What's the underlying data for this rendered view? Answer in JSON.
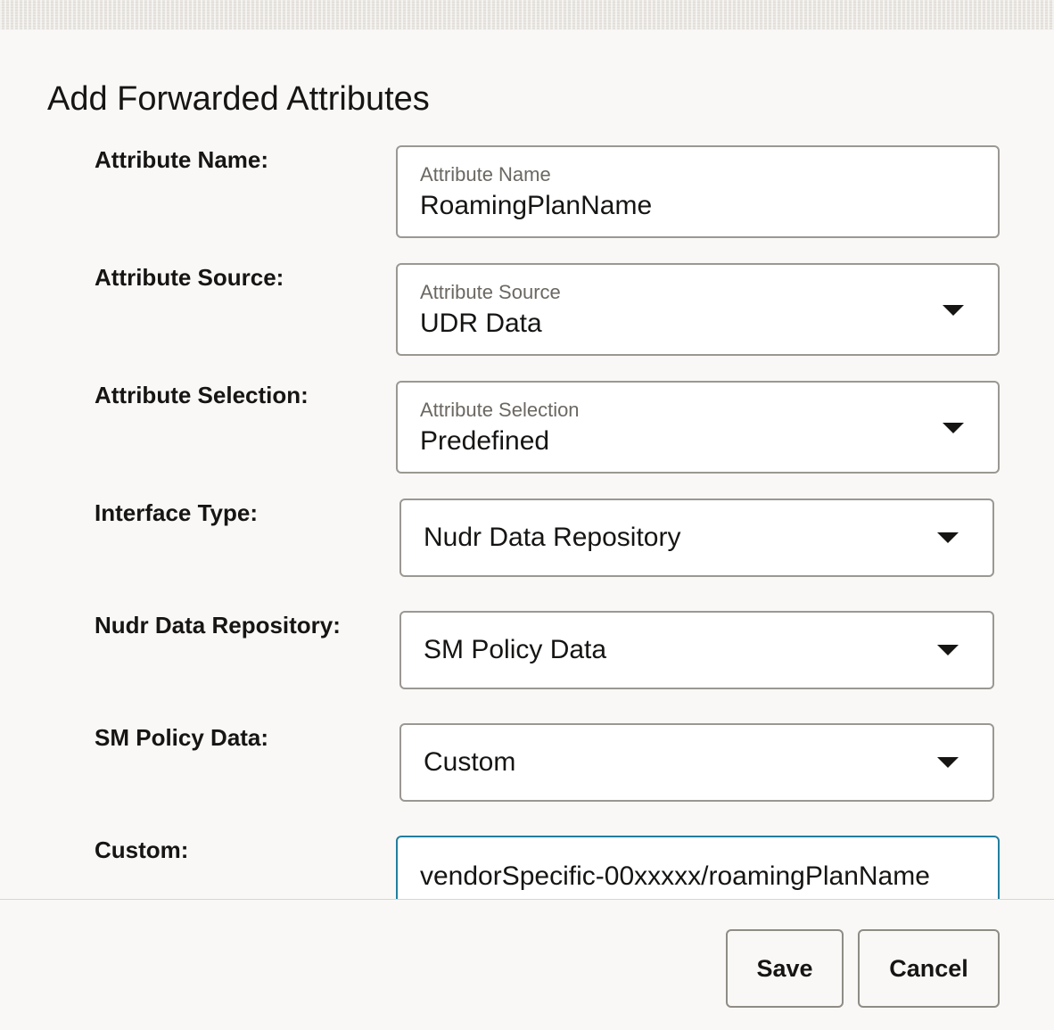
{
  "dialog": {
    "title": "Add Forwarded Attributes"
  },
  "form": {
    "attribute_name": {
      "row_label": "Attribute Name:",
      "field_label": "Attribute Name",
      "value": "RoamingPlanName"
    },
    "attribute_source": {
      "row_label": "Attribute Source:",
      "field_label": "Attribute Source",
      "value": "UDR Data"
    },
    "attribute_selection": {
      "row_label": "Attribute Selection:",
      "field_label": "Attribute Selection",
      "value": "Predefined"
    },
    "interface_type": {
      "row_label": "Interface Type:",
      "value": "Nudr Data Repository"
    },
    "nudr_data_repository": {
      "row_label": "Nudr Data Repository:",
      "value": "SM Policy Data"
    },
    "sm_policy_data": {
      "row_label": "SM Policy Data:",
      "value": "Custom"
    },
    "custom": {
      "row_label": "Custom:",
      "value": "vendorSpecific-00xxxxx/roamingPlanName"
    }
  },
  "footer": {
    "save_label": "Save",
    "cancel_label": "Cancel"
  },
  "icons": {
    "dropdown": "chevron-down-icon"
  },
  "colors": {
    "focus_border": "#227e9e",
    "field_border": "#9b9893",
    "text": "#161513"
  }
}
